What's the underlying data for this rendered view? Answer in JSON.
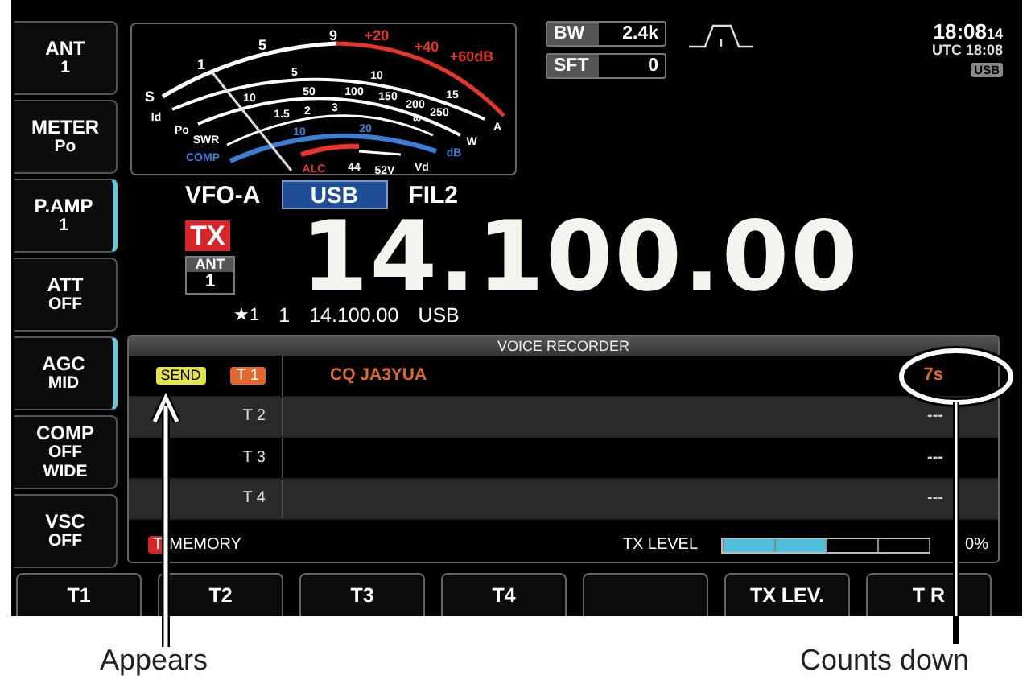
{
  "side_buttons": [
    {
      "lines": [
        "ANT",
        "1"
      ],
      "selected": false
    },
    {
      "lines": [
        "METER",
        "Po"
      ],
      "selected": false
    },
    {
      "lines": [
        "P.AMP",
        "1"
      ],
      "selected": true
    },
    {
      "lines": [
        "ATT",
        "OFF"
      ],
      "selected": false
    },
    {
      "lines": [
        "AGC",
        "MID"
      ],
      "selected": true
    },
    {
      "lines": [
        "COMP",
        "OFF",
        "WIDE"
      ],
      "selected": false
    },
    {
      "lines": [
        "VSC",
        "OFF"
      ],
      "selected": false
    }
  ],
  "meter": {
    "scales": [
      {
        "kind": "s",
        "labels": [
          "S",
          "1",
          "5",
          "9",
          "+20",
          "+40",
          "+60dB"
        ]
      },
      {
        "kind": "id",
        "labels": [
          "Id",
          "5",
          "10",
          "15",
          "A"
        ]
      },
      {
        "kind": "po",
        "labels": [
          "Po",
          "10",
          "50",
          "100",
          "150",
          "200",
          "250",
          "W"
        ]
      },
      {
        "kind": "swr",
        "labels": [
          "SWR",
          "1.5",
          "2",
          "3",
          "∞"
        ]
      },
      {
        "kind": "comp",
        "labels": [
          "COMP",
          "10",
          "20",
          "dB"
        ]
      },
      {
        "kind": "alc",
        "labels": [
          "ALC"
        ]
      },
      {
        "kind": "vd",
        "labels": [
          "44",
          "52V",
          "Vd"
        ]
      }
    ]
  },
  "filter": {
    "bw_label": "BW",
    "bw": "2.4k",
    "sft_label": "SFT",
    "sft": "0"
  },
  "clock": {
    "time": "18:08",
    "seconds": "14",
    "utc_label": "UTC",
    "utc": "18:08",
    "mode": "USB"
  },
  "vfo": {
    "name": "VFO-A",
    "mode": "USB",
    "filter": "FIL2",
    "tx": "TX",
    "ant_label": "ANT",
    "ant": "1",
    "frequency": "14.100.00",
    "memo": "★1",
    "memo_channel": "1",
    "memo_freq": "14.100.00",
    "memo_mode": "USB"
  },
  "recorder": {
    "title": "VOICE RECORDER",
    "rows": [
      {
        "label": "T 1",
        "active": true,
        "send": "SEND",
        "message": "CQ  JA3YUA",
        "time": "7s"
      },
      {
        "label": "T 2",
        "active": false,
        "time": "---"
      },
      {
        "label": "T 3",
        "active": false,
        "time": "---"
      },
      {
        "label": "T 4",
        "active": false,
        "time": "---"
      }
    ],
    "memory_badge": "T",
    "memory": "MEMORY",
    "tx_level_label": "TX LEVEL",
    "tx_level": {
      "level": 0.5
    },
    "tx_level_reading": "0%"
  },
  "bottom_buttons": [
    {
      "kind": "label",
      "label": "T1"
    },
    {
      "kind": "label",
      "label": "T2"
    },
    {
      "kind": "label",
      "label": "T3"
    },
    {
      "kind": "label",
      "label": "T4"
    },
    {
      "kind": "blank"
    },
    {
      "kind": "label",
      "label": "TX LEV."
    },
    {
      "kind": "label",
      "label": "T R"
    }
  ],
  "annotations": [
    {
      "kind": "arrow",
      "label": "Appears"
    },
    {
      "kind": "circle",
      "label": "Counts down"
    }
  ]
}
